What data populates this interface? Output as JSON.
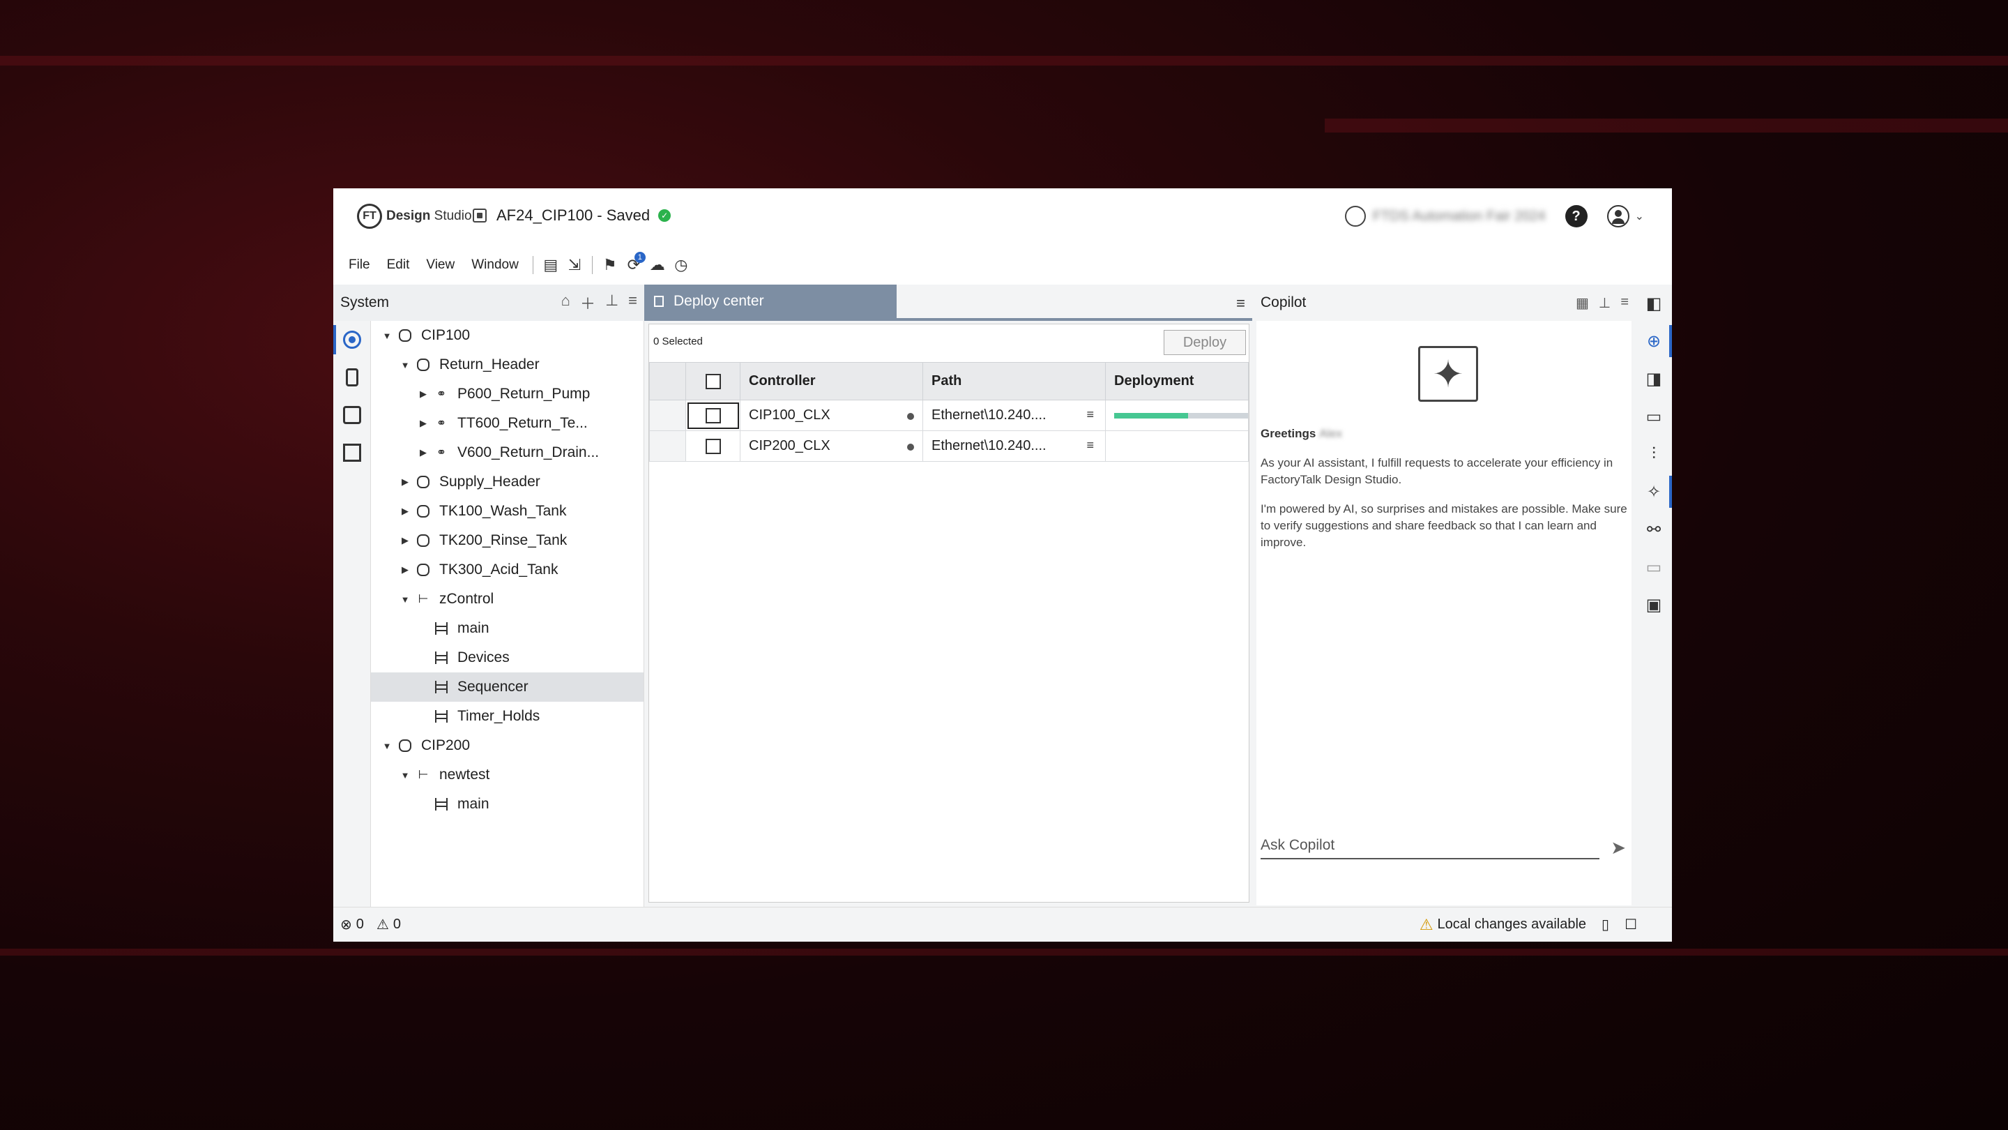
{
  "app": {
    "logo_mark": "FT",
    "logo_bold": "Design",
    "logo_light": "Studio",
    "project_title": "AF24_CIP100  - Saved",
    "saved_check": "✓",
    "org_name": "FTDS Automation Fair 2024",
    "help_label": "?"
  },
  "menu": [
    "File",
    "Edit",
    "View",
    "Window"
  ],
  "toolbar_badge": "1",
  "system_panel": {
    "title": "System",
    "tree": [
      {
        "label": "CIP100",
        "level": 0,
        "caret": "▼",
        "icon": "hex"
      },
      {
        "label": "Return_Header",
        "level": 1,
        "caret": "▼",
        "icon": "hex"
      },
      {
        "label": "P600_Return_Pump",
        "level": 2,
        "caret": "▶",
        "icon": "route"
      },
      {
        "label": "TT600_Return_Te...",
        "level": 2,
        "caret": "▶",
        "icon": "route"
      },
      {
        "label": "V600_Return_Drain...",
        "level": 2,
        "caret": "▶",
        "icon": "route"
      },
      {
        "label": "Supply_Header",
        "level": 1,
        "caret": "▶",
        "icon": "hex"
      },
      {
        "label": "TK100_Wash_Tank",
        "level": 1,
        "caret": "▶",
        "icon": "hex"
      },
      {
        "label": "TK200_Rinse_Tank",
        "level": 1,
        "caret": "▶",
        "icon": "hex"
      },
      {
        "label": "TK300_Acid_Tank",
        "level": 1,
        "caret": "▶",
        "icon": "hex"
      },
      {
        "label": "zControl",
        "level": 1,
        "caret": "▼",
        "icon": "prog"
      },
      {
        "label": "main",
        "level": 2,
        "caret": "",
        "icon": "ladder"
      },
      {
        "label": "Devices",
        "level": 2,
        "caret": "",
        "icon": "ladder"
      },
      {
        "label": "Sequencer",
        "level": 2,
        "caret": "",
        "icon": "ladder",
        "selected": true
      },
      {
        "label": "Timer_Holds",
        "level": 2,
        "caret": "",
        "icon": "ladder"
      },
      {
        "label": "CIP200",
        "level": 0,
        "caret": "▼",
        "icon": "hex"
      },
      {
        "label": "newtest",
        "level": 1,
        "caret": "▼",
        "icon": "prog"
      },
      {
        "label": "main",
        "level": 2,
        "caret": "",
        "icon": "ladder"
      }
    ]
  },
  "deploy_center": {
    "tab_label": "Deploy center",
    "selected_count": "0 Selected",
    "deploy_button": "Deploy",
    "columns": [
      "Controller",
      "Path",
      "Deployment"
    ],
    "rows": [
      {
        "controller": "CIP100_CLX",
        "path": "Ethernet\\10.240....",
        "progress": 0.55
      },
      {
        "controller": "CIP200_CLX",
        "path": "Ethernet\\10.240....",
        "progress": null
      }
    ]
  },
  "copilot": {
    "title": "Copilot",
    "greeting": "Greetings",
    "greeting_name": "Alex",
    "para1": "As your AI assistant, I fulfill requests to accelerate your efficiency in FactoryTalk Design Studio.",
    "para2": "I'm powered by AI, so surprises and mistakes are possible. Make sure to verify suggestions and share feedback so that I can learn and improve.",
    "input_placeholder": "Ask Copilot"
  },
  "status": {
    "errors": "0",
    "warnings": "0",
    "local_changes": "Local changes available"
  },
  "colors": {
    "accent": "#2a66c7",
    "tab": "#7d8ea3",
    "progress": "#46c792",
    "saved": "#2bb24c"
  }
}
